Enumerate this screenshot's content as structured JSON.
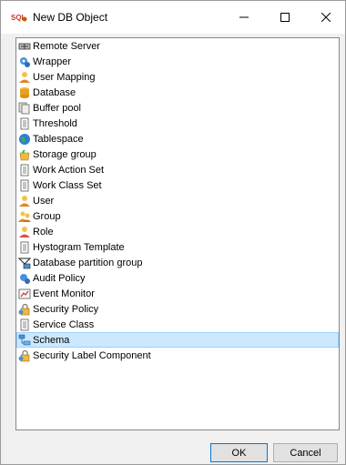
{
  "window": {
    "app_icon_text": "SQL",
    "title": "New DB Object",
    "minimize_glyph": "—",
    "maximize_glyph": "☐",
    "close_glyph": "✕"
  },
  "list": {
    "items": [
      {
        "label": "Remote Server",
        "icon": "remote-server-icon"
      },
      {
        "label": "Wrapper",
        "icon": "wrapper-icon"
      },
      {
        "label": "User Mapping",
        "icon": "user-mapping-icon"
      },
      {
        "label": "Database",
        "icon": "database-icon"
      },
      {
        "label": "Buffer pool",
        "icon": "buffer-pool-icon"
      },
      {
        "label": "Threshold",
        "icon": "document-icon"
      },
      {
        "label": "Tablespace",
        "icon": "globe-icon"
      },
      {
        "label": "Storage group",
        "icon": "storage-group-icon"
      },
      {
        "label": "Work Action Set",
        "icon": "document-icon"
      },
      {
        "label": "Work Class Set",
        "icon": "document-icon"
      },
      {
        "label": "User",
        "icon": "user-icon"
      },
      {
        "label": "Group",
        "icon": "group-icon"
      },
      {
        "label": "Role",
        "icon": "role-icon"
      },
      {
        "label": "Hystogram Template",
        "icon": "document-icon"
      },
      {
        "label": "Database partition group",
        "icon": "partition-group-icon"
      },
      {
        "label": "Audit Policy",
        "icon": "audit-policy-icon"
      },
      {
        "label": "Event Monitor",
        "icon": "event-monitor-icon"
      },
      {
        "label": "Security Policy",
        "icon": "security-policy-icon"
      },
      {
        "label": "Service Class",
        "icon": "document-icon"
      },
      {
        "label": "Schema",
        "icon": "schema-icon"
      },
      {
        "label": "Security Label Component",
        "icon": "security-label-icon"
      }
    ],
    "selected_index": 19
  },
  "buttons": {
    "ok": "OK",
    "cancel": "Cancel"
  },
  "colors": {
    "selection_bg": "#cce8ff",
    "selection_border": "#99d1ff",
    "ok_border": "#0078d7"
  }
}
